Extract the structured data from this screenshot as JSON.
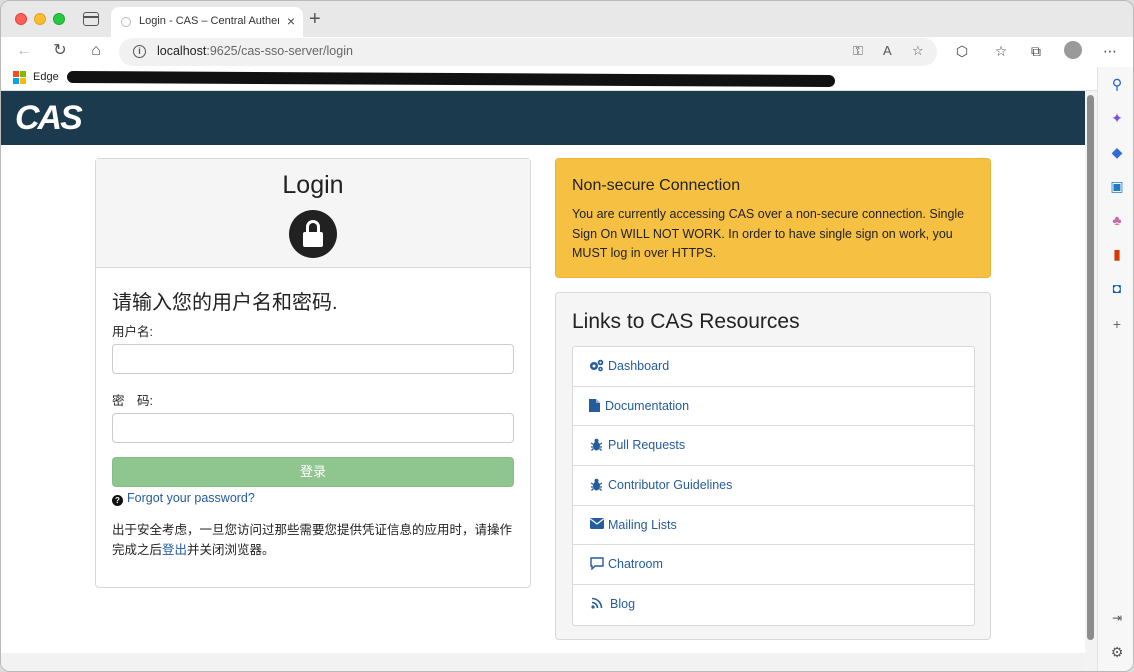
{
  "browser": {
    "tab_title": "Login - CAS – Central Authentication Service",
    "url_host": "localhost",
    "url_path": ":9625/cas-sso-server/login",
    "bookmark_edge": "Edge"
  },
  "header": {
    "logo_text": "CAS",
    "brand_color": "#1c3a4e"
  },
  "login": {
    "title": "Login",
    "prompt": "请输入您的用户名和密码.",
    "username_label": "用户名:",
    "username_value": "",
    "password_label": "密　码:",
    "password_value": "",
    "submit_label": "登录",
    "forgot_label": "Forgot your password?",
    "security_pre": "出于安全考虑，一旦您访问过那些需要您提供凭证信息的应用时，请操作完成之后",
    "security_link": "登出",
    "security_post": "并关闭浏览器。"
  },
  "warning": {
    "title": "Non-secure Connection",
    "body": "You are currently accessing CAS over a non-secure connection. Single Sign On WILL NOT WORK. In order to have single sign on work, you MUST log in over HTTPS.",
    "color": "#f6c143"
  },
  "resources": {
    "title": "Links to CAS Resources",
    "items": [
      {
        "label": "Dashboard",
        "icon": "cogs-icon"
      },
      {
        "label": "Documentation",
        "icon": "file-icon"
      },
      {
        "label": "Pull Requests",
        "icon": "bug-icon"
      },
      {
        "label": "Contributor Guidelines",
        "icon": "bug-icon"
      },
      {
        "label": "Mailing Lists",
        "icon": "envelope-icon"
      },
      {
        "label": "Chatroom",
        "icon": "comment-icon"
      },
      {
        "label": "Blog",
        "icon": "rss-icon"
      }
    ]
  }
}
